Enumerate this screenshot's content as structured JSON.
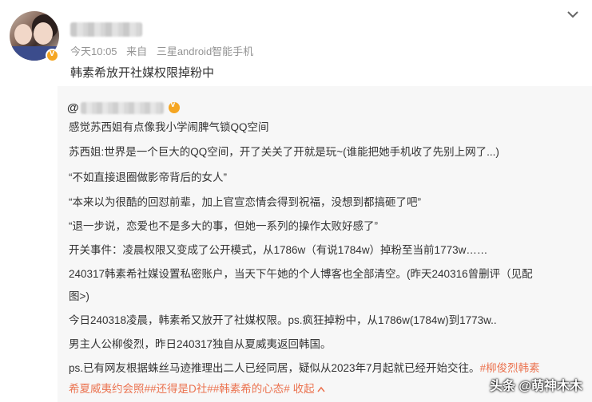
{
  "post": {
    "time": "今天10:05",
    "source_prefix": "来自",
    "source": "三星android智能手机",
    "title": "韩素希放开社媒权限掉粉中"
  },
  "repost": {
    "at_symbol": "@",
    "lines": [
      "感觉苏西姐有点像我小学闹脾气锁QQ空间",
      "苏西姐:世界是一个巨大的QQ空间，开了关关了开就是玩~(谁能把她手机收了先别上网了...)",
      "“不如直接退圈做影帝背后的女人”",
      "“本来以为很酷的回怼前辈，加上官宣恋情会得到祝福，没想到都搞砸了吧”",
      "“退一步说，恋爱也不是多大的事，但她一系列的操作太败好感了”",
      "开关事件：凌晨权限又变成了公开模式，从1786w（有说1784w）掉粉至当前1773w……",
      "240317韩素希社媒设置私密账户，当天下午她的个人博客也全部清空。(昨天240316曾删评（见配",
      "图>)",
      "今日240318凌晨，韩素希又放开了社媒权限。ps.疯狂掉粉中，从1786w(1784w)到1773w..",
      "男主人公柳俊烈，昨日240317独自从夏威夷返回韩国。",
      "ps.已有网友根据蛛丝马迹推理出二人已经同居，疑似从2023年7月起就已经开始交往。"
    ],
    "tag1_part1": "#柳俊烈韩素",
    "tag1_part2": "希夏威夷约会照#",
    "tag2": "#还得是D社#",
    "tag3": "#韩素希的心态#",
    "collapse": "收起",
    "collapse_icon": "chevron-up-icon"
  },
  "watermark": "头条 @萌神木木",
  "colors": {
    "tag": "#eb7350",
    "badge": "#f5a623",
    "meta": "#939393"
  }
}
